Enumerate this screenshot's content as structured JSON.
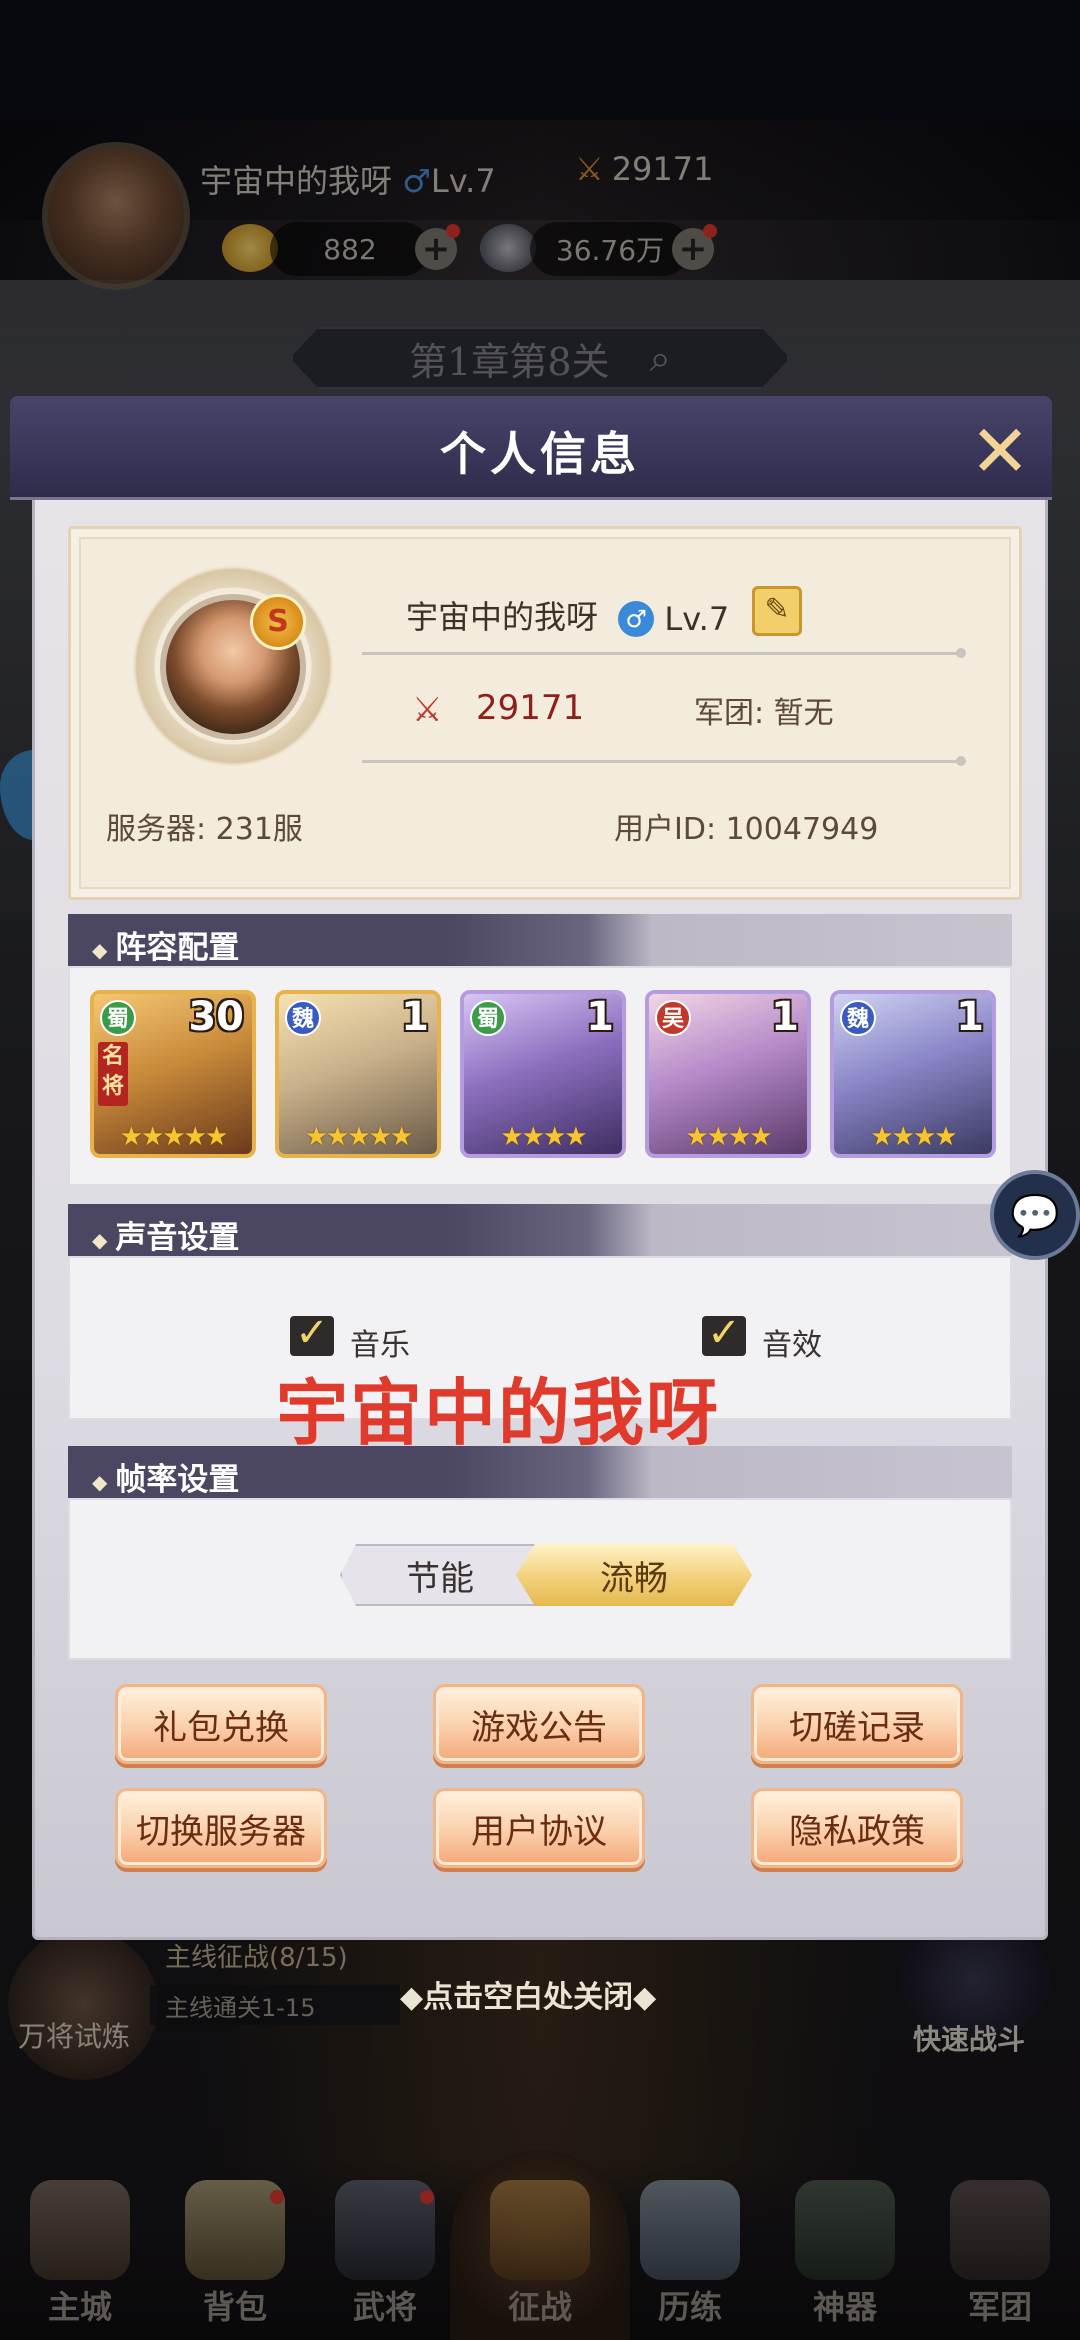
{
  "top_hud": {
    "player_name": "宇宙中的我呀",
    "gender_symbol": "♂",
    "level": "Lv.7",
    "power": "29171",
    "gold": "882",
    "silver": "36.76万",
    "stage": "第1章第8关"
  },
  "modal": {
    "title": "个人信息",
    "close_symbol": "✕",
    "profile": {
      "name": "宇宙中的我呀",
      "gender_symbol": "♂",
      "level": "Lv.7",
      "power": "29171",
      "legion": "军团: 暂无",
      "server": "服务器: 231服",
      "user_id": "用户ID:  10047949",
      "badge_symbol": "S",
      "edit_symbol": "✎"
    },
    "lineup": {
      "title": "阵容配置",
      "heroes": [
        {
          "faction": "蜀",
          "level": "30",
          "stars": "★★★★★",
          "rarity": "gold",
          "tag": "名将"
        },
        {
          "faction": "魏",
          "level": "1",
          "stars": "★★★★★",
          "rarity": "gold"
        },
        {
          "faction": "蜀",
          "level": "1",
          "stars": "★★★★",
          "rarity": "purple"
        },
        {
          "faction": "吴",
          "level": "1",
          "stars": "★★★★",
          "rarity": "purple"
        },
        {
          "faction": "魏",
          "level": "1",
          "stars": "★★★★",
          "rarity": "purple"
        }
      ]
    },
    "sound": {
      "title": "声音设置",
      "music_label": "音乐",
      "music_checked": true,
      "sfx_label": "音效",
      "sfx_checked": true,
      "check_symbol": "✓"
    },
    "watermark_text": "宇宙中的我呀",
    "framerate": {
      "title": "帧率设置",
      "option_saver": "节能",
      "option_smooth": "流畅",
      "selected": "流畅"
    },
    "buttons": {
      "gift_code": "礼包兑换",
      "announcement": "游戏公告",
      "battle_record": "切磋记录",
      "switch_server": "切换服务器",
      "user_agreement": "用户协议",
      "privacy_policy": "隐私政策"
    }
  },
  "bottom": {
    "trial_label": "万将试炼",
    "main_quest": "主线征战(8/15)",
    "main_quest_sub": "主线通关1-15",
    "close_hint": "◆点击空白处关闭◆",
    "fast_battle": "快速战斗",
    "nav": [
      "主城",
      "背包",
      "武将",
      "征战",
      "历练",
      "神器",
      "军团"
    ]
  },
  "colors": {
    "header_purple": "#393659",
    "power_red": "#8e1f1a",
    "watermark_red": "#e03a2c",
    "button_orange": "#f4a878",
    "selected_gold": "#f3d380"
  },
  "icons": {
    "chat": "chat-bubbles-icon",
    "map_pin": "map-pin-icon"
  }
}
